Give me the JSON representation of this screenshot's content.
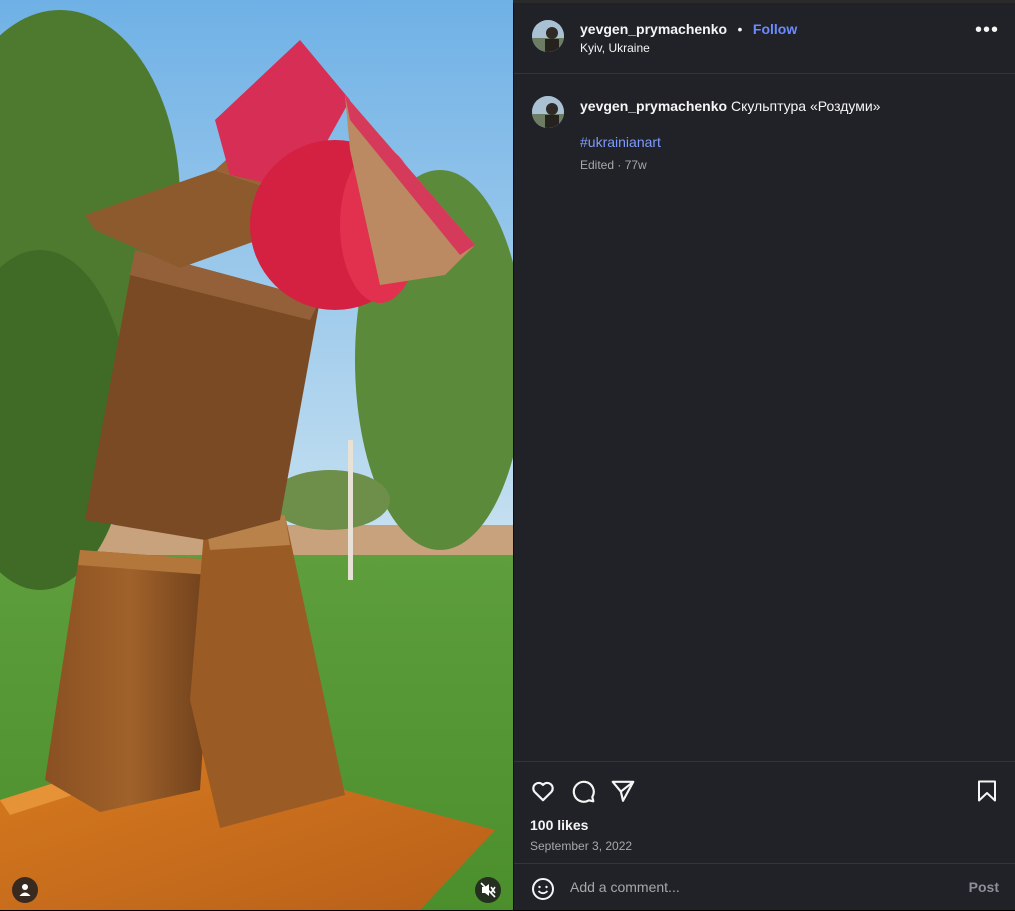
{
  "post": {
    "username": "yevgen_prymachenko",
    "separator": "•",
    "follow_label": "Follow",
    "location": "Kyiv, Ukraine",
    "more_icon": "more-horizontal-icon",
    "more_glyph": "•••"
  },
  "caption": {
    "username": "yevgen_prymachenko",
    "text": "Скульптура «Роздуми»",
    "hashtag": "#ukrainianart",
    "meta": "Edited · 77w"
  },
  "actions": {
    "like_icon": "heart-icon",
    "comment_icon": "comment-icon",
    "share_icon": "send-icon",
    "save_icon": "bookmark-icon"
  },
  "stats": {
    "likes": "100 likes",
    "date": "September 3, 2022"
  },
  "comment": {
    "placeholder": "Add a comment...",
    "post_label": "Post",
    "emoji_icon": "emoji-icon"
  },
  "media": {
    "tagged_icon": "user-tag-icon",
    "mute_icon": "muted-speaker-icon"
  },
  "colors": {
    "panel_bg": "#212228",
    "link": "#6b8bff",
    "hashtag": "#7c9bff",
    "secondary_text": "#a8a8a8"
  }
}
